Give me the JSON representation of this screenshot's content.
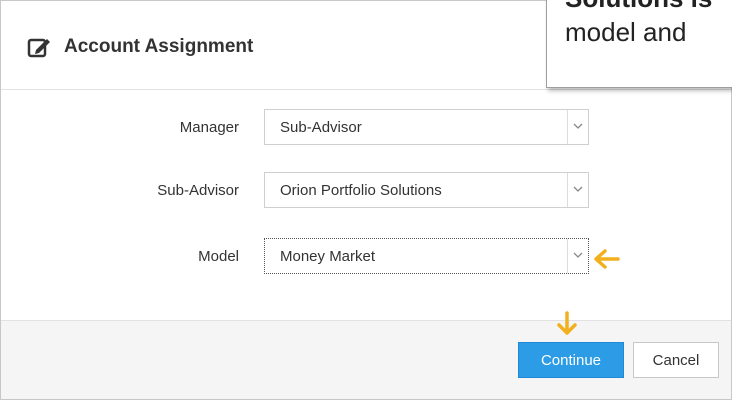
{
  "dialog": {
    "title": "Account Assignment",
    "title_icon": "edit-icon"
  },
  "callout": {
    "line1": "Solutions is",
    "line2": "model and"
  },
  "form": {
    "manager": {
      "label": "Manager",
      "value": "Sub-Advisor"
    },
    "sub_advisor": {
      "label": "Sub-Advisor",
      "value": "Orion Portfolio Solutions"
    },
    "model": {
      "label": "Model",
      "value": "Money Market"
    }
  },
  "footer": {
    "continue_label": "Continue",
    "cancel_label": "Cancel"
  },
  "colors": {
    "accent": "#2c9ce6",
    "pointer": "#f2b01e"
  }
}
